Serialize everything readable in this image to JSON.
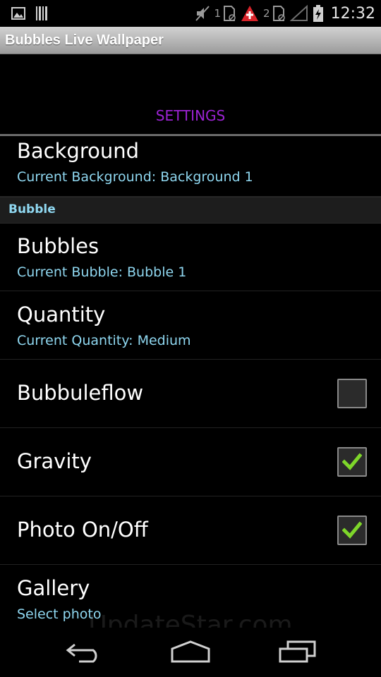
{
  "status_bar": {
    "sim1_label": "1",
    "sim2_label": "2",
    "time": "12:32",
    "icons": [
      "image-icon",
      "barcode-icon",
      "mute-icon",
      "sim1-icon",
      "alert-icon",
      "sim2-icon",
      "signal-icon",
      "battery-icon"
    ]
  },
  "app": {
    "title": "Bubbles Live Wallpaper"
  },
  "settings": {
    "header": "SETTINGS"
  },
  "prefs": {
    "background": {
      "title": "Background",
      "summary": "Current Background: Background 1"
    },
    "category_bubble": "Bubble",
    "bubbles": {
      "title": "Bubbles",
      "summary": "Current Bubble: Bubble 1"
    },
    "quantity": {
      "title": "Quantity",
      "summary": "Current Quantity: Medium"
    },
    "bubbuleflow": {
      "title": "Bubbuleflow",
      "checked": false
    },
    "gravity": {
      "title": "Gravity",
      "checked": true
    },
    "photo": {
      "title": "Photo On/Off",
      "checked": true
    },
    "gallery": {
      "title": "Gallery",
      "summary": "Select photo"
    }
  },
  "watermark": "UpdateStar.com",
  "nav": {
    "icons": [
      "back-icon",
      "home-icon",
      "recents-icon"
    ]
  },
  "colors": {
    "accent_purple": "#9c23d4",
    "summary_blue": "#8fd7f0",
    "check_green": "#7ed62a"
  }
}
